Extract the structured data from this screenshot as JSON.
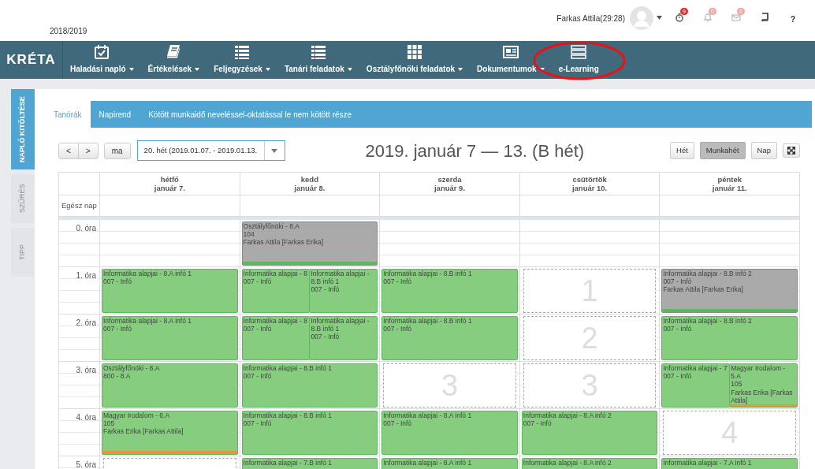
{
  "header": {
    "school_year": "2018/2019",
    "user": "Farkas Attila(29:28)",
    "badges": [
      {
        "count": "9",
        "color": "#d9342b"
      },
      {
        "count": "0",
        "color": "#f0a8a3"
      },
      {
        "count": "0",
        "color": "#f0a8a3"
      }
    ],
    "help": "?"
  },
  "logo": "KRÉTA",
  "nav": [
    {
      "label": "Haladási napló",
      "dropdown": true
    },
    {
      "label": "Értékelések",
      "dropdown": true
    },
    {
      "label": "Feljegyzések",
      "dropdown": true
    },
    {
      "label": "Tanári feladatok",
      "dropdown": true
    },
    {
      "label": "Osztályfőnöki feladatok",
      "dropdown": true
    },
    {
      "label": "Dokumentumok",
      "dropdown": true
    },
    {
      "label": "e-Learning",
      "dropdown": false
    }
  ],
  "side_tabs": [
    {
      "label": "NAPLÓ KITÖLTÉSE",
      "selected": true
    },
    {
      "label": "SZŰRÉS",
      "selected": false
    },
    {
      "label": "TIPP",
      "selected": false
    }
  ],
  "tabs": [
    {
      "label": "Tanórák",
      "selected": true
    },
    {
      "label": "Napirend",
      "selected": false
    },
    {
      "label": "Kötött munkaidő neveléssel-oktatással le nem kötött része",
      "selected": false
    }
  ],
  "toolbar": {
    "prev": "<",
    "next": ">",
    "today": "ma",
    "week_select": "20. hét (2019.01.07. - 2019.01.13.",
    "title": "2019. január 7 — 13. (B hét)",
    "views": [
      {
        "label": "Hét",
        "selected": false
      },
      {
        "label": "Munkahét",
        "selected": true
      },
      {
        "label": "Nap",
        "selected": false
      }
    ]
  },
  "calendar": {
    "days": [
      {
        "day": "hétfő",
        "date": "január 7."
      },
      {
        "day": "kedd",
        "date": "január 8."
      },
      {
        "day": "szerda",
        "date": "január 9."
      },
      {
        "day": "csütörtök",
        "date": "január 10."
      },
      {
        "day": "péntek",
        "date": "január 11."
      }
    ],
    "all_day": "Egész nap",
    "rows": [
      {
        "label": "0. óra",
        "cells": [
          {
            "kind": "blank"
          },
          {
            "kind": "lessons",
            "events": [
              {
                "lines": [
                  "Osztályfőnöki - 8.A",
                  "104",
                  "Farkas Attila [Farkas Erika]"
                ],
                "color": "#aaaaaa",
                "bar": {
                  "color": "#5cb85c"
                }
              }
            ]
          },
          {
            "kind": "blank"
          },
          {
            "kind": "blank"
          },
          {
            "kind": "blank"
          }
        ]
      },
      {
        "label": "1. óra",
        "cells": [
          {
            "kind": "lessons",
            "events": [
              {
                "lines": [
                  "Informatika alapjai - 8.A infó 1",
                  "007 - Infó"
                ],
                "color": "#86cd80"
              }
            ]
          },
          {
            "kind": "lessons",
            "events": [
              {
                "lines": [
                  "Informatika alapjai - 8",
                  "007 - Infó"
                ],
                "color": "#86cd80"
              },
              {
                "lines": [
                  "Informatika alapjai - 8.B infó 1",
                  "007 - Infó"
                ],
                "color": "#86cd80"
              }
            ]
          },
          {
            "kind": "lessons",
            "events": [
              {
                "lines": [
                  "Informatika alapjai - 8.B infó 1",
                  "007 - Infó"
                ],
                "color": "#86cd80"
              }
            ]
          },
          {
            "kind": "free",
            "number": "1"
          },
          {
            "kind": "lessons",
            "events": [
              {
                "lines": [
                  "Informatika alapjai - 8.B infó 2",
                  "007 - Infó",
                  "Farkas Attila [Farkas Erika]"
                ],
                "color": "#aaaaaa",
                "bar": {
                  "color": "#5cb85c"
                }
              }
            ]
          }
        ]
      },
      {
        "label": "2. óra",
        "cells": [
          {
            "kind": "lessons",
            "events": [
              {
                "lines": [
                  "Informatika alapjai - 8.A infó 1",
                  "007 - Infó"
                ],
                "color": "#86cd80"
              }
            ]
          },
          {
            "kind": "lessons",
            "events": [
              {
                "lines": [
                  "Informatika alapjai - 8",
                  "007 - Infó"
                ],
                "color": "#86cd80"
              },
              {
                "lines": [
                  "Informatika alapjai - 8.B infó 1",
                  "007 - Infó"
                ],
                "color": "#86cd80"
              }
            ]
          },
          {
            "kind": "lessons",
            "events": [
              {
                "lines": [
                  "Informatika alapjai - 8.B infó 1",
                  "007 - Infó"
                ],
                "color": "#86cd80"
              }
            ]
          },
          {
            "kind": "free",
            "number": "2"
          },
          {
            "kind": "lessons",
            "events": [
              {
                "lines": [
                  "Informatika alapjai - 8.B infó 2",
                  "007 - Infó"
                ],
                "color": "#86cd80"
              }
            ]
          }
        ]
      },
      {
        "label": "3. óra",
        "cells": [
          {
            "kind": "lessons",
            "events": [
              {
                "lines": [
                  "Osztályfőnöki - 8.A",
                  "800 - 8.A"
                ],
                "color": "#86cd80"
              }
            ]
          },
          {
            "kind": "lessons",
            "events": [
              {
                "lines": [
                  "Informatika alapjai - 8.B infó 1",
                  "007 - Infó"
                ],
                "color": "#86cd80"
              }
            ]
          },
          {
            "kind": "free",
            "number": "3"
          },
          {
            "kind": "free",
            "number": "3"
          },
          {
            "kind": "lessons",
            "events": [
              {
                "lines": [
                  "Informatika alapjai - 7",
                  "007 - Infó"
                ],
                "color": "#86cd80"
              },
              {
                "lines": [
                  "Magyar Irodalom - 5.A",
                  "105",
                  "Farkas Erika [Farkas Attila]"
                ],
                "color": "#86cd80",
                "bar": {
                  "color": "#f0913a"
                }
              }
            ]
          }
        ]
      },
      {
        "label": "4. óra",
        "cells": [
          {
            "kind": "lessons",
            "events": [
              {
                "lines": [
                  "Magyar Irodalom - 6.A",
                  "105",
                  "Farkas Erika [Farkas Attila]"
                ],
                "color": "#86cd80",
                "bar": {
                  "color": "#f0913a"
                }
              }
            ]
          },
          {
            "kind": "lessons",
            "events": [
              {
                "lines": [
                  "Informatika alapjai - 8.B infó 1",
                  "007 - Infó"
                ],
                "color": "#86cd80"
              }
            ]
          },
          {
            "kind": "lessons",
            "events": [
              {
                "lines": [
                  "Informatika alapjai - 8.A infó 1",
                  "007 - Infó"
                ],
                "color": "#86cd80"
              }
            ]
          },
          {
            "kind": "lessons",
            "events": [
              {
                "lines": [
                  "Informatika alapjai - 8.A infó 2",
                  "007 - Infó"
                ],
                "color": "#86cd80"
              }
            ]
          },
          {
            "kind": "free",
            "number": "4"
          }
        ]
      },
      {
        "label": "5. óra",
        "cells": [
          {
            "kind": "free"
          },
          {
            "kind": "lessons",
            "events": [
              {
                "lines": [
                  "Informatika alapjai - 7.B infó 1"
                ],
                "color": "#86cd80"
              }
            ]
          },
          {
            "kind": "lessons",
            "events": [
              {
                "lines": [
                  "Informatika alapjai - 8.A infó 1"
                ],
                "color": "#86cd80"
              }
            ]
          },
          {
            "kind": "lessons",
            "events": [
              {
                "lines": [
                  "Informatika alapjai - 8.A infó 2"
                ],
                "color": "#86cd80"
              }
            ]
          },
          {
            "kind": "lessons",
            "events": [
              {
                "lines": [
                  "Informatika alapjai - 7.A infó 1"
                ],
                "color": "#86cd80"
              }
            ]
          }
        ]
      }
    ]
  }
}
